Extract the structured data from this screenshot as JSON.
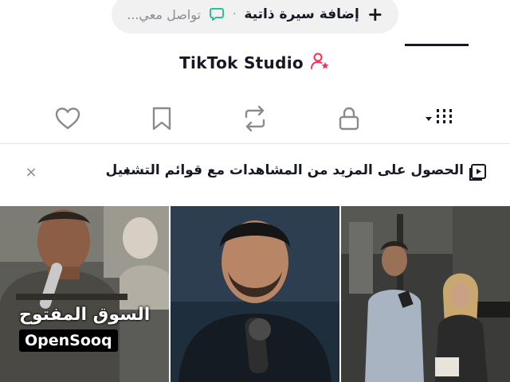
{
  "profile": {
    "add_bio": "إضافة سيرة ذاتية",
    "separator": "·",
    "contact": "تواصل معي...",
    "studio": "TikTok Studio"
  },
  "tabs": [
    {
      "name": "liked",
      "icon": "heart-icon"
    },
    {
      "name": "favorites",
      "icon": "bookmark-icon"
    },
    {
      "name": "reposts",
      "icon": "repost-icon"
    },
    {
      "name": "private",
      "icon": "lock-icon"
    },
    {
      "name": "videos",
      "icon": "grid-icon",
      "active": true
    }
  ],
  "banner": {
    "text": "الحصول على المزيد من المشاهدات مع قوائم التشغيل",
    "chevron": "‹",
    "close": "×"
  },
  "watermark": {
    "arabic": "السوق المفتوح",
    "latin": "OpenSooq"
  },
  "colors": {
    "text": "#161823",
    "muted": "#8a8b91",
    "accent_pink": "#fe2c55",
    "accent_green": "#25c29d",
    "pill_bg": "#f1f1f2"
  }
}
